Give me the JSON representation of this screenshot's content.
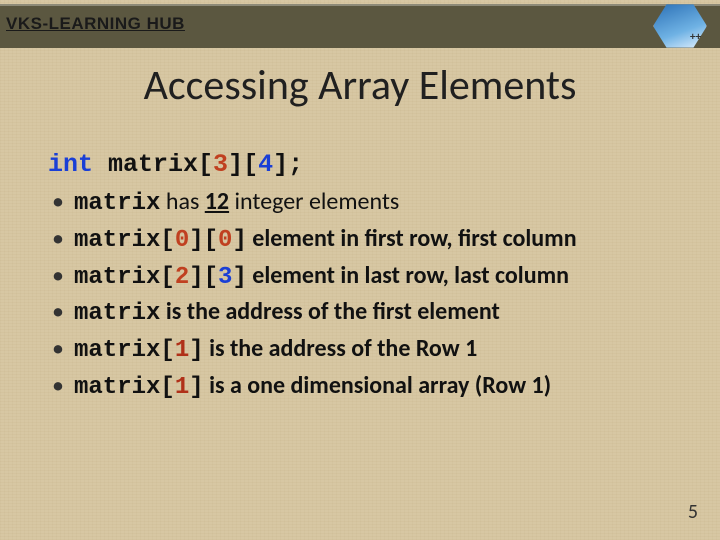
{
  "brand": "VKS-LEARNING HUB",
  "cpp_pp": "++",
  "title": "Accessing Array Elements",
  "decl": {
    "kw": "int",
    "pre": " matrix[",
    "d1": "3",
    "mid": "][",
    "d2": "4",
    "post": "];"
  },
  "bullets": {
    "b1": {
      "code": "matrix",
      "t1": " has ",
      "num": "12",
      "t2": " integer elements"
    },
    "b2": {
      "p0": "matrix[",
      "n0a": "0",
      "p1": "][",
      "n0b": "0",
      "p2": "]",
      "text": " element in first row, first column"
    },
    "b3": {
      "p0": "matrix[",
      "n2": "2",
      "p1": "][",
      "n3": "3",
      "p2": "]",
      "text": "  element in last row, last column"
    },
    "b4": {
      "code": "matrix",
      "text": "  is the address of the first element"
    },
    "b5": {
      "p0": "matrix[",
      "n1": "1",
      "p1": "]",
      "text": " is the address of the Row 1"
    },
    "b6": {
      "p0": "matrix[",
      "n1": "1",
      "p1": "]",
      "text": "  is a one dimensional  array (Row 1)"
    }
  },
  "page_number": "5"
}
